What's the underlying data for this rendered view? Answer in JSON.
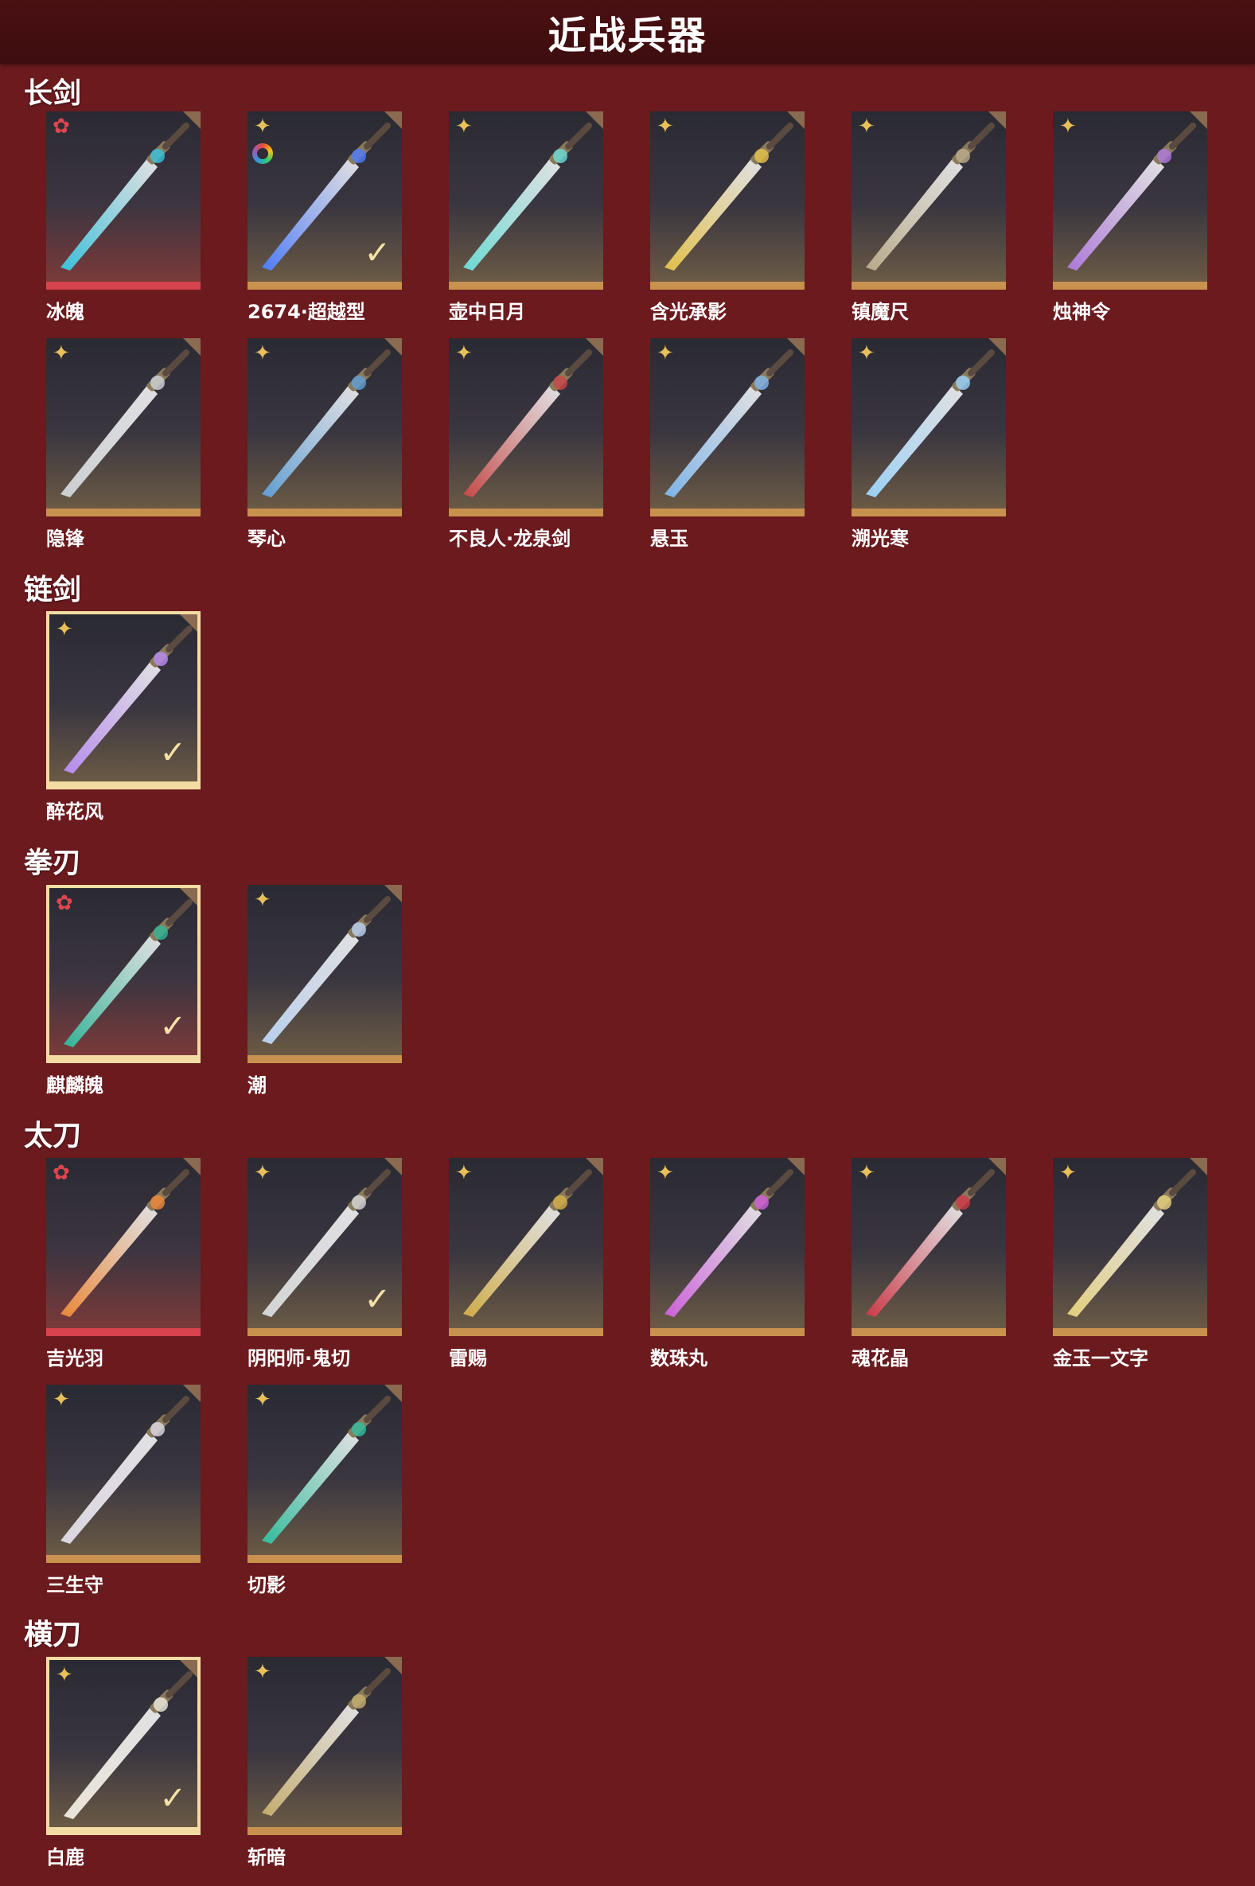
{
  "page": {
    "title": "近战兵器"
  },
  "sections": {
    "longsword": {
      "title": "长剑"
    },
    "chainsword": {
      "title": "链剑"
    },
    "fistblade": {
      "title": "拳刃"
    },
    "katana": {
      "title": "太刀"
    },
    "sabre": {
      "title": "横刀"
    }
  },
  "weapons": {
    "longsword": [
      {
        "name": "冰魄",
        "rank": "red",
        "selected": false,
        "checked": false
      },
      {
        "name": "2674·超越型",
        "rank": "gold",
        "selected": false,
        "checked": true,
        "ring": true
      },
      {
        "name": "壶中日月",
        "rank": "gold",
        "selected": false,
        "checked": false
      },
      {
        "name": "含光承影",
        "rank": "gold",
        "selected": false,
        "checked": false
      },
      {
        "name": "镇魔尺",
        "rank": "gold",
        "selected": false,
        "checked": false
      },
      {
        "name": "烛神令",
        "rank": "gold",
        "selected": false,
        "checked": false
      },
      {
        "name": "隐锋",
        "rank": "gold",
        "selected": false,
        "checked": false
      },
      {
        "name": "琴心",
        "rank": "gold",
        "selected": false,
        "checked": false
      },
      {
        "name": "不良人·龙泉剑",
        "rank": "gold",
        "selected": false,
        "checked": false
      },
      {
        "name": "悬玉",
        "rank": "gold",
        "selected": false,
        "checked": false
      },
      {
        "name": "溯光寒",
        "rank": "gold",
        "selected": false,
        "checked": false
      }
    ],
    "chainsword": [
      {
        "name": "醉花风",
        "rank": "gold",
        "selected": true,
        "checked": true
      }
    ],
    "fistblade": [
      {
        "name": "麒麟魄",
        "rank": "red",
        "selected": true,
        "checked": true
      },
      {
        "name": "潮",
        "rank": "gold",
        "selected": false,
        "checked": false
      }
    ],
    "katana": [
      {
        "name": "吉光羽",
        "rank": "red",
        "selected": false,
        "checked": false
      },
      {
        "name": "阴阳师·鬼切",
        "rank": "gold",
        "selected": false,
        "checked": true
      },
      {
        "name": "雷赐",
        "rank": "gold",
        "selected": false,
        "checked": false
      },
      {
        "name": "数珠丸",
        "rank": "gold",
        "selected": false,
        "checked": false
      },
      {
        "name": "魂花晶",
        "rank": "gold",
        "selected": false,
        "checked": false
      },
      {
        "name": "金玉一文字",
        "rank": "gold",
        "selected": false,
        "checked": false
      },
      {
        "name": "三生守",
        "rank": "gold",
        "selected": false,
        "checked": false
      },
      {
        "name": "切影",
        "rank": "gold",
        "selected": false,
        "checked": false
      }
    ],
    "sabre": [
      {
        "name": "白鹿",
        "rank": "gold",
        "selected": true,
        "checked": true
      },
      {
        "name": "斩暗",
        "rank": "gold",
        "selected": false,
        "checked": false
      }
    ]
  },
  "colors": {
    "background": "#6b1a1e",
    "header": "#3d0d0f",
    "gold_frame": "#c8924e",
    "red_frame": "#d8434d",
    "selected_frame": "#f2dca3"
  },
  "icons": {
    "gold_rank": "gold-star-badge-icon",
    "red_rank": "red-star-badge-icon",
    "check": "checkmark-icon"
  }
}
